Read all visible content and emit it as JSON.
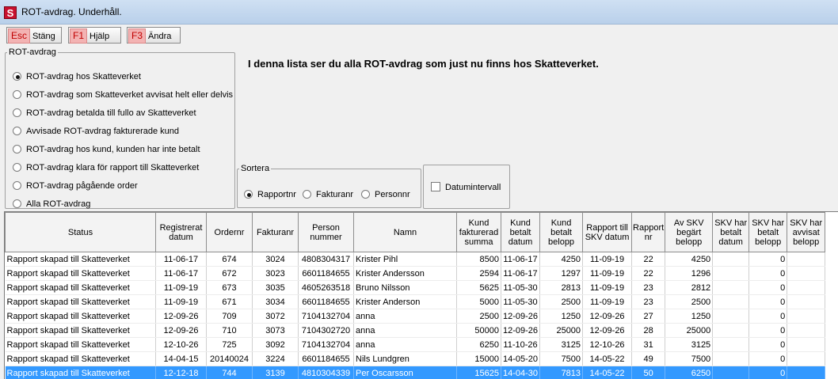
{
  "window": {
    "title": "ROT-avdrag. Underhåll.",
    "icon_letter": "S"
  },
  "toolbar": [
    {
      "key": "Esc",
      "label": "Stäng"
    },
    {
      "key": "F1",
      "label": "Hjälp"
    },
    {
      "key": "F3",
      "label": "Ändra"
    }
  ],
  "rot_group": {
    "legend": "ROT-avdrag",
    "options": [
      {
        "label": "ROT-avdrag hos Skatteverket",
        "selected": true
      },
      {
        "label": "ROT-avdrag som Skatteverket avvisat helt eller delvis",
        "selected": false
      },
      {
        "label": "ROT-avdrag betalda till fullo av Skatteverket",
        "selected": false
      },
      {
        "label": "Avvisade ROT-avdrag fakturerade kund",
        "selected": false
      },
      {
        "label": "ROT-avdrag hos kund, kunden har inte betalt",
        "selected": false
      },
      {
        "label": "ROT-avdrag klara för rapport till Skatteverket",
        "selected": false
      },
      {
        "label": "ROT-avdrag pågående order",
        "selected": false
      },
      {
        "label": "Alla ROT-avdrag",
        "selected": false
      }
    ]
  },
  "info_text": "I denna lista ser du alla ROT-avdrag som just nu finns hos Skatteverket.",
  "sort_group": {
    "legend": "Sortera",
    "options": [
      {
        "label": "Rapportnr",
        "selected": true
      },
      {
        "label": "Fakturanr",
        "selected": false
      },
      {
        "label": "Personnr",
        "selected": false
      }
    ]
  },
  "date_range": {
    "label": "Datumintervall",
    "checked": false
  },
  "table": {
    "columns": [
      "Status",
      "Registrerat datum",
      "Ordernr",
      "Fakturanr",
      "Person nummer",
      "Namn",
      "Kund fakturerad summa",
      "Kund betalt datum",
      "Kund betalt belopp",
      "Rapport till SKV datum",
      "Rapport nr",
      "Av SKV begärt belopp",
      "SKV har betalt datum",
      "SKV har betalt belopp",
      "SKV har avvisat belopp"
    ],
    "rows": [
      [
        "Rapport skapad till Skatteverket",
        "11-06-17",
        "674",
        "3024",
        "4808304317",
        "Krister Pihl",
        "8500",
        "11-06-17",
        "4250",
        "11-09-19",
        "22",
        "4250",
        "",
        "0",
        ""
      ],
      [
        "Rapport skapad till Skatteverket",
        "11-06-17",
        "672",
        "3023",
        "6601184655",
        "Krister Andersson",
        "2594",
        "11-06-17",
        "1297",
        "11-09-19",
        "22",
        "1296",
        "",
        "0",
        ""
      ],
      [
        "Rapport skapad till Skatteverket",
        "11-09-19",
        "673",
        "3035",
        "4605263518",
        "Bruno Nilsson",
        "5625",
        "11-05-30",
        "2813",
        "11-09-19",
        "23",
        "2812",
        "",
        "0",
        ""
      ],
      [
        "Rapport skapad till Skatteverket",
        "11-09-19",
        "671",
        "3034",
        "6601184655",
        "Krister Anderson",
        "5000",
        "11-05-30",
        "2500",
        "11-09-19",
        "23",
        "2500",
        "",
        "0",
        ""
      ],
      [
        "Rapport skapad till Skatteverket",
        "12-09-26",
        "709",
        "3072",
        "7104132704",
        "anna",
        "2500",
        "12-09-26",
        "1250",
        "12-09-26",
        "27",
        "1250",
        "",
        "0",
        ""
      ],
      [
        "Rapport skapad till Skatteverket",
        "12-09-26",
        "710",
        "3073",
        "7104302720",
        "anna",
        "50000",
        "12-09-26",
        "25000",
        "12-09-26",
        "28",
        "25000",
        "",
        "0",
        ""
      ],
      [
        "Rapport skapad till Skatteverket",
        "12-10-26",
        "725",
        "3092",
        "7104132704",
        "anna",
        "6250",
        "11-10-26",
        "3125",
        "12-10-26",
        "31",
        "3125",
        "",
        "0",
        ""
      ],
      [
        "Rapport skapad till Skatteverket",
        "14-04-15",
        "20140024",
        "3224",
        "6601184655",
        "Nils Lundgren",
        "15000",
        "14-05-20",
        "7500",
        "14-05-22",
        "49",
        "7500",
        "",
        "0",
        ""
      ],
      [
        "Rapport skapad till Skatteverket",
        "12-12-18",
        "744",
        "3139",
        "4810304339",
        "Per Oscarsson",
        "15625",
        "14-04-30",
        "7813",
        "14-05-22",
        "50",
        "6250",
        "",
        "0",
        ""
      ]
    ],
    "selected_row": 8
  }
}
